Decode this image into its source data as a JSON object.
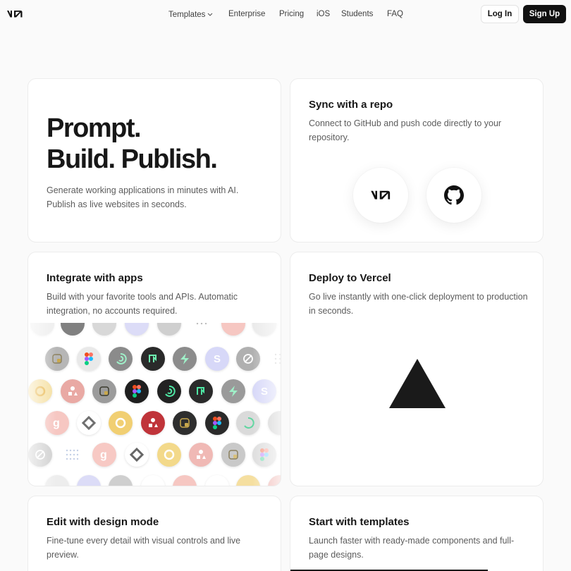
{
  "header": {
    "logo_alt": "v0",
    "nav": [
      {
        "label": "Templates",
        "has_dropdown": true
      },
      {
        "label": "Enterprise"
      },
      {
        "label": "Pricing"
      },
      {
        "label": "iOS"
      },
      {
        "label": "Students"
      },
      {
        "label": "FAQ"
      }
    ],
    "login_label": "Log In",
    "signup_label": "Sign Up"
  },
  "hero": {
    "line1": "Prompt.",
    "line2": "Build. Publish.",
    "description": "Generate working applications in minutes with AI. Publish as live websites in seconds."
  },
  "sync_card": {
    "title": "Sync with a repo",
    "description": "Connect to GitHub and push code directly to your repository.",
    "icons": [
      "v0-logo-icon",
      "github-icon"
    ]
  },
  "integrate_card": {
    "title": "Integrate with apps",
    "description": "Build with your favorite tools and APIs. Automatic integration, no accounts required.",
    "app_icons": [
      "neon-icon",
      "figma-icon",
      "openai-icon",
      "notion-icon",
      "supabase-icon",
      "stripe-icon",
      "grok-icon",
      "groq-icon",
      "sanity-icon",
      "ring-icon",
      "upstash-icon",
      "elevenlabs-icon"
    ]
  },
  "deploy_card": {
    "title": "Deploy to Vercel",
    "description": "Go live instantly with one-click deployment to production in seconds.",
    "icon": "vercel-triangle-icon"
  },
  "design_card": {
    "title": "Edit with design mode",
    "description": "Fine-tune every detail with visual controls and live preview."
  },
  "templates_card": {
    "title": "Start with templates",
    "description": "Launch faster with ready-made components and full-page designs."
  },
  "colors": {
    "background": "#fafafa",
    "text": "#171717",
    "muted": "#5c5c5c",
    "button_dark": "#111111"
  }
}
